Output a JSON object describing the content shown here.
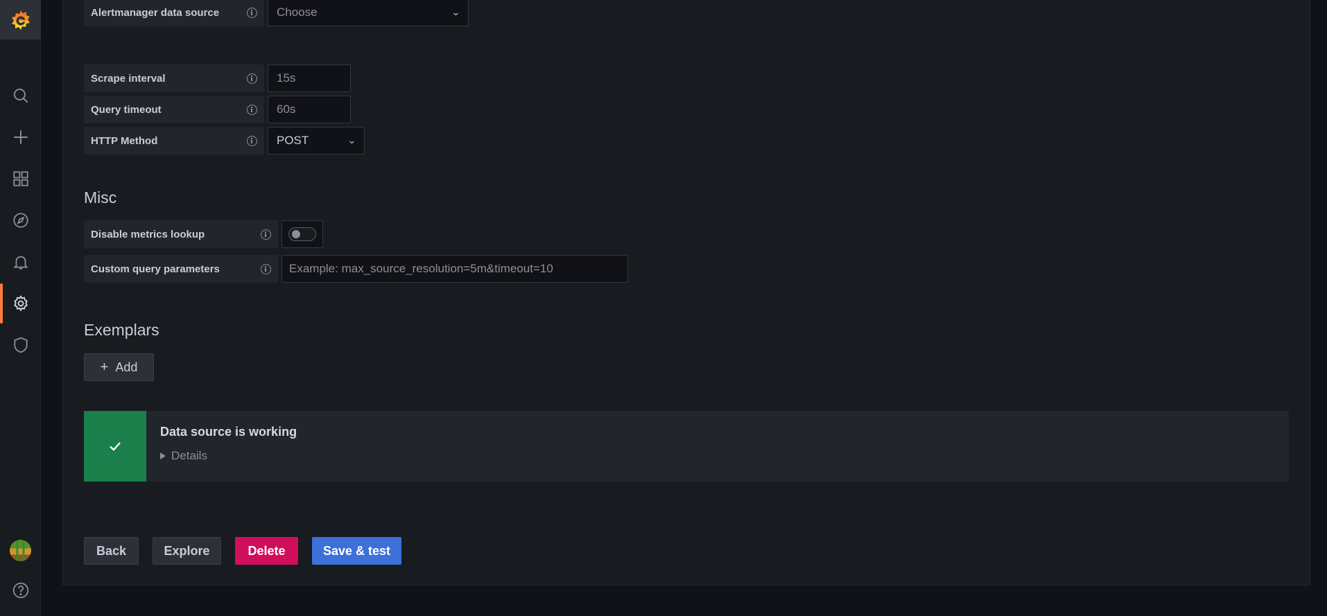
{
  "http": {
    "alertmanager_label": "Alertmanager data source",
    "alertmanager_value": "Choose",
    "scrape_label": "Scrape interval",
    "scrape_placeholder": "15s",
    "timeout_label": "Query timeout",
    "timeout_placeholder": "60s",
    "method_label": "HTTP Method",
    "method_value": "POST"
  },
  "misc": {
    "title": "Misc",
    "disable_lookup_label": "Disable metrics lookup",
    "disable_lookup_enabled": false,
    "custom_params_label": "Custom query parameters",
    "custom_params_placeholder": "Example: max_source_resolution=5m&timeout=10"
  },
  "exemplars": {
    "title": "Exemplars",
    "add_label": "Add"
  },
  "status": {
    "title": "Data source is working",
    "details": "Details",
    "color": "#1a7f4b"
  },
  "actions": {
    "back": "Back",
    "explore": "Explore",
    "delete": "Delete",
    "save": "Save & test"
  },
  "sidemenu": {
    "items": [
      "search-icon",
      "plus-icon",
      "dashboards-icon",
      "explore-icon",
      "alerting-icon",
      "configuration-icon",
      "server-admin-icon"
    ],
    "active": "configuration-icon",
    "accent": "#ff7a3d"
  }
}
